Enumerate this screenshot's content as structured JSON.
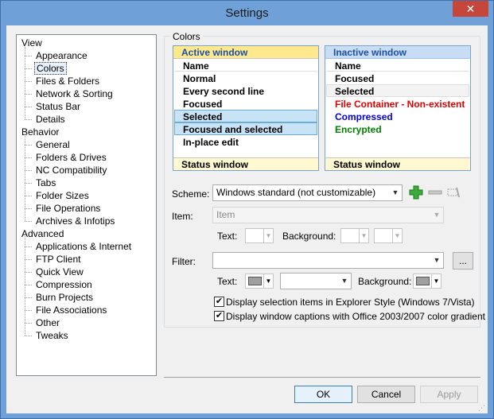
{
  "window": {
    "title": "Settings",
    "close_glyph": "✕"
  },
  "tree": {
    "items": [
      {
        "label": "View",
        "level": 0
      },
      {
        "label": "Appearance",
        "level": 1
      },
      {
        "label": "Colors",
        "level": 1,
        "selected": true
      },
      {
        "label": "Files & Folders",
        "level": 1
      },
      {
        "label": "Network & Sorting",
        "level": 1
      },
      {
        "label": "Status Bar",
        "level": 1
      },
      {
        "label": "Details",
        "level": 1
      },
      {
        "label": "Behavior",
        "level": 0
      },
      {
        "label": "General",
        "level": 1
      },
      {
        "label": "Folders & Drives",
        "level": 1
      },
      {
        "label": "NC Compatibility",
        "level": 1
      },
      {
        "label": "Tabs",
        "level": 1
      },
      {
        "label": "Folder Sizes",
        "level": 1
      },
      {
        "label": "File Operations",
        "level": 1
      },
      {
        "label": "Archives & Infotips",
        "level": 1
      },
      {
        "label": "Advanced",
        "level": 0
      },
      {
        "label": "Applications & Internet",
        "level": 1
      },
      {
        "label": "FTP Client",
        "level": 1
      },
      {
        "label": "Quick View",
        "level": 1
      },
      {
        "label": "Compression",
        "level": 1
      },
      {
        "label": "Burn Projects",
        "level": 1
      },
      {
        "label": "File Associations",
        "level": 1
      },
      {
        "label": "Other",
        "level": 1
      },
      {
        "label": "Tweaks",
        "level": 1
      }
    ]
  },
  "colors": {
    "group_title": "Colors",
    "active": {
      "header": "Active window",
      "rows": [
        {
          "label": "Name",
          "cls": "name"
        },
        {
          "label": "Normal",
          "cls": ""
        },
        {
          "label": "Every second line",
          "cls": ""
        },
        {
          "label": "Focused",
          "cls": ""
        },
        {
          "label": "Selected",
          "cls": "sel"
        },
        {
          "label": "Focused and selected",
          "cls": "focsel"
        },
        {
          "label": "In-place edit",
          "cls": ""
        }
      ],
      "status": "Status window"
    },
    "inactive": {
      "header": "Inactive window",
      "rows": [
        {
          "label": "Name",
          "cls": "name"
        },
        {
          "label": "Focused",
          "cls": ""
        },
        {
          "label": "Selected",
          "cls": "sel"
        },
        {
          "label": "File Container - Non-existent",
          "cls": "",
          "color": "#e00000"
        },
        {
          "label": "Compressed",
          "cls": "",
          "color": "#0000e0"
        },
        {
          "label": "Encrypted",
          "cls": "",
          "color": "#008000"
        }
      ],
      "status": "Status window"
    },
    "scheme_label": "Scheme:",
    "scheme_value": "Windows standard (not customizable)",
    "item_label": "Item:",
    "item_value": "Item",
    "text_label": "Text:",
    "background_label": "Background:",
    "filter_label": "Filter:",
    "filter_value": "",
    "browse_label": "...",
    "text_label2": "Text:",
    "background_label2": "Background:",
    "check1": "Display selection items in Explorer Style (Windows 7/Vista)",
    "check2": "Display window captions with Office 2003/2007 color gradient",
    "check_glyph": "✔",
    "accent_green": "#3caa3c"
  },
  "footer": {
    "ok": "OK",
    "cancel": "Cancel",
    "apply": "Apply"
  }
}
